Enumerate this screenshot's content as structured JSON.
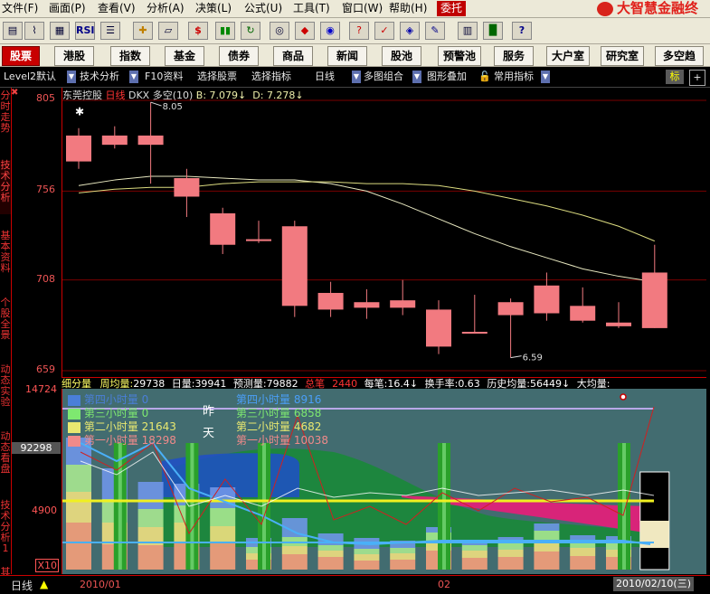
{
  "menu": {
    "items": [
      {
        "label": "文件(F)"
      },
      {
        "label": "画面(P)"
      },
      {
        "label": "查看(V)"
      },
      {
        "label": "分析(A)"
      },
      {
        "label": "决策(L)"
      },
      {
        "label": "公式(U)"
      },
      {
        "label": "工具(T)"
      },
      {
        "label": "窗口(W)"
      },
      {
        "label": "帮助(H)"
      }
    ],
    "entrust": "委托",
    "brand": "大智慧金融终"
  },
  "toolbar": {
    "icons": [
      "folder-icon",
      "chart-icon",
      "grid-icon",
      "rsi-icon",
      "crosshair-icon",
      "ruler-icon",
      "dollar-icon",
      "bar-color-icon",
      "binoculars-icon",
      "stock-icon",
      "globe-icon",
      "check-icon",
      "money-icon",
      "book-icon",
      "help-icon"
    ],
    "rsi_label": "RSI"
  },
  "quickbar": {
    "items": [
      "股票",
      "港股",
      "指数",
      "基金",
      "债券",
      "商品",
      "新闻",
      "股池",
      "预警池",
      "服务",
      "大户室",
      "研究室",
      "多空趋"
    ]
  },
  "tabs": [
    {
      "label": "Level2默认"
    },
    {
      "label": "技术分析"
    },
    {
      "label": "F10资料"
    },
    {
      "label": "选择股票"
    },
    {
      "label": "选择指标"
    },
    {
      "label": "日线"
    },
    {
      "label": "多图组合"
    },
    {
      "label": "图形叠加"
    },
    {
      "label": "常用指标"
    }
  ],
  "tab_right": {
    "mark": "标",
    "plus": "+"
  },
  "sidebar": {
    "tabs": [
      "分时走势",
      "技术分析",
      "基本资料",
      "个股全景",
      "动态实验",
      "动态看盘",
      "技术分析1",
      "其他"
    ]
  },
  "chart_header": {
    "name": "东莞控股",
    "period": "日线",
    "indicator": "DKX 多空(10)",
    "b_value": "B: 7.079↓",
    "d_value": "D: 7.278↓"
  },
  "info_bar": [
    {
      "label": "细分量",
      "value": ""
    },
    {
      "label": "周均量:",
      "value": "29738"
    },
    {
      "label": "日量:",
      "value": "39941"
    },
    {
      "label": "预测量:",
      "value": "79882"
    },
    {
      "label": "总笔",
      "value": "2440"
    },
    {
      "label": "每笔:",
      "value": "16.4↓"
    },
    {
      "label": "换手率:",
      "value": "0.63"
    },
    {
      "label": "历史均量:",
      "value": "56449↓"
    },
    {
      "label": "大均量:",
      "value": ""
    }
  ],
  "vol_legend": {
    "left": [
      {
        "label": "第四小时量",
        "value": "0",
        "color": "#4a7fd8"
      },
      {
        "label": "第三小时量",
        "value": "0",
        "color": "#7ee870"
      },
      {
        "label": "第二小时量",
        "value": "21643",
        "color": "#e8e870"
      },
      {
        "label": "第一小时量",
        "value": "18298",
        "color": "#f08a8a"
      }
    ],
    "middle_top": "昨",
    "middle_bottom": "天",
    "right": [
      {
        "label": "第四小时量",
        "value": "8916"
      },
      {
        "label": "第三小时量",
        "value": "6858"
      },
      {
        "label": "第二小时量",
        "value": "4682"
      },
      {
        "label": "第一小时量",
        "value": "10038"
      }
    ]
  },
  "vol_axis": {
    "top": "14724",
    "mid": "92298",
    "low": "4900",
    "unit": "X10"
  },
  "status": {
    "period": "日线",
    "date_start": "2010/01",
    "date_mid": "02",
    "date_end": "2010/02/10(三)"
  },
  "colors": {
    "up": "#f27a80",
    "down": "#84f0f8",
    "ma_white": "#e8e8c0",
    "ma_yellow": "#dcdc80",
    "grid": "#7a0000",
    "axis_text": "#e55555"
  },
  "chart_data": {
    "type": "candlestick",
    "y_ticks": [
      805,
      756,
      708,
      659
    ],
    "ylim": [
      659,
      805
    ],
    "annotations": [
      {
        "label": "8.05"
      },
      {
        "label": "6.59"
      }
    ],
    "candles": [
      {
        "open": 772,
        "close": 786,
        "high": 790,
        "low": 768
      },
      {
        "open": 781,
        "close": 786,
        "high": 791,
        "low": 779
      },
      {
        "open": 781,
        "close": 786,
        "high": 804,
        "low": 760
      },
      {
        "open": 753,
        "close": 763,
        "high": 768,
        "low": 742
      },
      {
        "open": 727,
        "close": 744,
        "high": 747,
        "low": 722
      },
      {
        "open": 729,
        "close": 730,
        "high": 740,
        "low": 728
      },
      {
        "open": 694,
        "close": 737,
        "high": 740,
        "low": 688
      },
      {
        "open": 692,
        "close": 701,
        "high": 707,
        "low": 688
      },
      {
        "open": 693,
        "close": 696,
        "high": 703,
        "low": 687
      },
      {
        "open": 693,
        "close": 697,
        "high": 708,
        "low": 689
      },
      {
        "open": 672,
        "close": 692,
        "high": 697,
        "low": 668
      },
      {
        "open": 679,
        "close": 680,
        "high": 700,
        "low": 679
      },
      {
        "open": 689,
        "close": 696,
        "high": 698,
        "low": 666
      },
      {
        "open": 690,
        "close": 705,
        "high": 712,
        "low": 686
      },
      {
        "open": 686,
        "close": 694,
        "high": 704,
        "low": 685
      },
      {
        "open": 683,
        "close": 685,
        "high": 696,
        "low": 682
      },
      {
        "open": 682,
        "close": 712,
        "high": 727,
        "low": 682
      }
    ],
    "series": [
      {
        "values": [
          759,
          762,
          764,
          764,
          763,
          762,
          762,
          760,
          756,
          749,
          741,
          733,
          726,
          720,
          714,
          710,
          707
        ]
      },
      {
        "values": [
          755,
          757,
          758,
          758,
          760,
          761,
          761,
          761,
          760,
          760,
          759,
          756,
          752,
          748,
          743,
          737,
          729
        ]
      }
    ]
  },
  "volume_data": {
    "type": "stacked-bar",
    "bars": [
      {
        "q1": 52,
        "q2": 34,
        "q3": 30,
        "q4": 30
      },
      {
        "q1": 28,
        "q2": 24,
        "q3": 26,
        "q4": 34
      },
      {
        "q1": 27,
        "q2": 20,
        "q3": 20,
        "q4": 30
      },
      {
        "q1": 31,
        "q2": 21,
        "q3": 19,
        "q4": 24
      },
      {
        "q1": 29,
        "q2": 19,
        "q3": 20,
        "q4": 23
      },
      {
        "q1": 11,
        "q2": 7,
        "q3": 7,
        "q4": 10
      },
      {
        "q1": 17,
        "q2": 9,
        "q3": 10,
        "q4": 21
      },
      {
        "q1": 14,
        "q2": 7,
        "q3": 6,
        "q4": 13
      },
      {
        "q1": 10,
        "q2": 7,
        "q3": 6,
        "q4": 12
      },
      {
        "q1": 11,
        "q2": 7,
        "q3": 6,
        "q4": 8
      },
      {
        "q1": 21,
        "q2": 10,
        "q3": 10,
        "q4": 6
      },
      {
        "q1": 13,
        "q2": 8,
        "q3": 6,
        "q4": 6
      },
      {
        "q1": 14,
        "q2": 8,
        "q3": 7,
        "q4": 7
      },
      {
        "q1": 20,
        "q2": 12,
        "q3": 11,
        "q4": 8
      },
      {
        "q1": 15,
        "q2": 9,
        "q3": 7,
        "q4": 7
      },
      {
        "q1": 14,
        "q2": 8,
        "q3": 8,
        "q4": 7
      },
      {
        "q1": 22,
        "q2": 13,
        "q3": 0,
        "q4": 0
      }
    ]
  }
}
